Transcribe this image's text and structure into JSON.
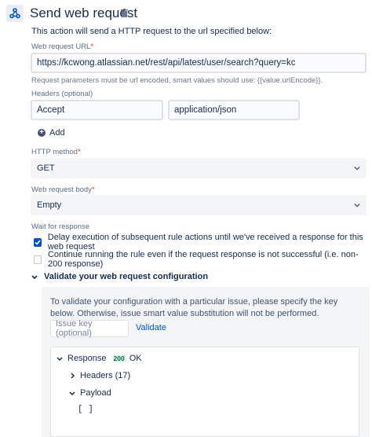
{
  "header": {
    "title": "Send web request",
    "icon": "webhook-icon",
    "delete_icon": "trash-icon"
  },
  "description": "This action will send a HTTP request to the url specified below:",
  "url": {
    "label": "Web request URL",
    "required_mark": "*",
    "value": "https://kcwong.atlassian.net/rest/api/latest/user/search?query=kc",
    "help": "Request parameters must be url encoded, smart values should use: {{value.urlEncode}}."
  },
  "headers": {
    "label": "Headers (optional)",
    "rows": [
      {
        "name": "Accept",
        "value": "application/json"
      }
    ],
    "add_label": "Add"
  },
  "http_method": {
    "label": "HTTP method",
    "required_mark": "*",
    "selected": "GET"
  },
  "body": {
    "label": "Web request body",
    "required_mark": "*",
    "selected": "Empty"
  },
  "wait": {
    "label": "Wait for response",
    "options": [
      {
        "label": "Delay execution of subsequent rule actions until we've received a response for this web request",
        "checked": true
      },
      {
        "label": "Continue running the rule even if the request response is not successful (i.e. non-200 response)",
        "checked": false
      }
    ]
  },
  "validate": {
    "toggle_label": "Validate your web request configuration",
    "text": "To validate your configuration with a particular issue, please specify the key below. Otherwise, issue smart value substitution will not be performed.",
    "input_placeholder": "Issue key (optional)",
    "button_label": "Validate",
    "response": {
      "label": "Response",
      "status_code": "200",
      "status_text": "OK",
      "headers_label": "Headers (17)",
      "payload_label": "Payload",
      "payload_value": "[ ]"
    }
  },
  "colors": {
    "primary": "#0052cc",
    "text": "#172b4d",
    "muted": "#5e6c84",
    "required": "#de350b",
    "success_bg": "#e3fcef",
    "success_text": "#006644"
  }
}
